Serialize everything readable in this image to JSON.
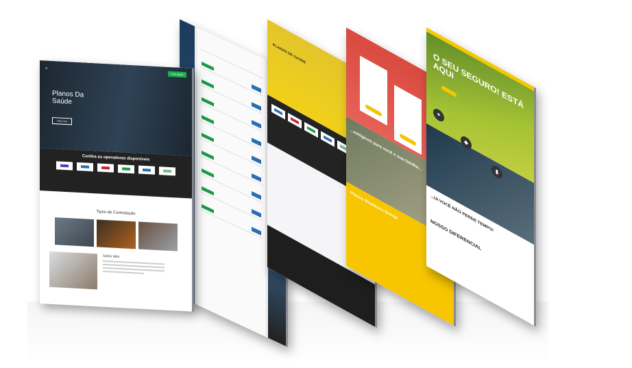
{
  "page1": {
    "title": "Planos Da Saúde",
    "cta": "Fale agora",
    "hero_button": "Saiba mais",
    "operators_heading": "Confira as operadoras disponíveis",
    "types_heading": "Tipos de Contratação",
    "about_heading": "Sobre Mim"
  },
  "page3": {
    "heading": "PLANOS DE SAÚDE"
  },
  "page4": {
    "family_text": "...tológicos para você e sua família...",
    "section_title": "Planos Bradesco Dental"
  },
  "page5": {
    "hero_title": "O SEU SEGURO! ESTÁ AQUI",
    "tagline": "...UI VOCÊ NÃO PERDE TEMPO!",
    "differential": "NOSSO DIFERENCIAL"
  },
  "colors": {
    "green": "#1bb14c",
    "yellow": "#f6c800",
    "red": "#d94a3f",
    "dark": "#222222"
  }
}
